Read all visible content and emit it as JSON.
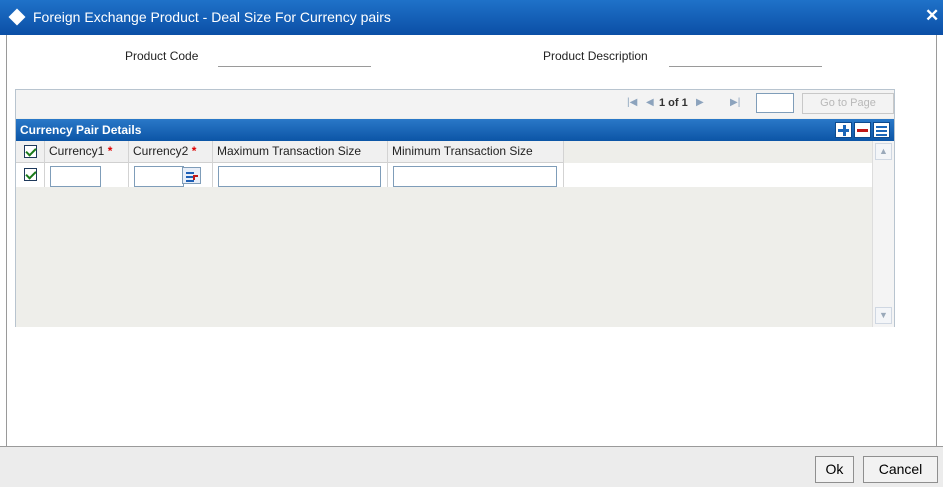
{
  "window": {
    "title": "Foreign Exchange Product - Deal Size For Currency pairs",
    "close_glyph": "✕"
  },
  "header": {
    "product_code_label": "Product Code",
    "product_code_value": "",
    "product_description_label": "Product Description",
    "product_description_value": ""
  },
  "pagination": {
    "first_glyph": "|◀",
    "prev_glyph": "◀",
    "page_text": "1 of 1",
    "next_glyph": "▶",
    "last_glyph": "▶|",
    "page_input_value": "",
    "goto_label": "Go to Page"
  },
  "block": {
    "title": "Currency Pair Details",
    "icons": [
      "add-row-icon",
      "delete-row-icon",
      "single-view-icon"
    ]
  },
  "table": {
    "columns": [
      {
        "label": "Currency1",
        "required": true
      },
      {
        "label": "Currency2",
        "required": true
      },
      {
        "label": "Maximum Transaction Size",
        "required": false
      },
      {
        "label": "Minimum Transaction Size",
        "required": false
      }
    ],
    "required_marker": "*",
    "rows": [
      {
        "selected": true,
        "currency1": "",
        "currency2": "",
        "max_size": "",
        "min_size": ""
      }
    ]
  },
  "scroll": {
    "up_glyph": "▲",
    "down_glyph": "▼"
  },
  "footer": {
    "ok_label": "Ok",
    "cancel_label": "Cancel"
  },
  "colors": {
    "titlebar": "#0b4fa6",
    "block_header": "#0c55a6",
    "required": "#dd0000",
    "panel_bg": "#eeeeea"
  }
}
